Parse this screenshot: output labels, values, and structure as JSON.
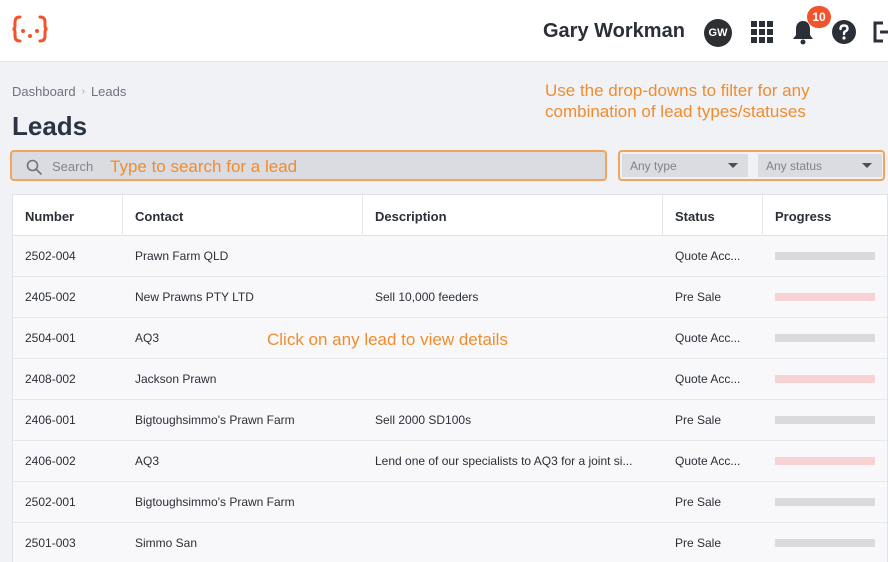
{
  "header": {
    "user_name": "Gary Workman",
    "avatar_initials": "GW",
    "notifications_count": "10",
    "icons": [
      "logo-icon",
      "apps-grid-icon",
      "bell-icon",
      "help-icon",
      "logout-icon"
    ],
    "accent_color": "#f0542c"
  },
  "breadcrumb": {
    "items": [
      "Dashboard",
      "Leads"
    ]
  },
  "page": {
    "title": "Leads"
  },
  "search": {
    "placeholder": "Search"
  },
  "filters": {
    "type_label": "Any type",
    "status_label": "Any status"
  },
  "hints": {
    "filter": "Use the drop-downs to filter for any combination of lead types/statuses",
    "search": "Type to search for a lead",
    "click": "Click on any lead to view details"
  },
  "table": {
    "columns": [
      "Number",
      "Contact",
      "Description",
      "Status",
      "Progress"
    ],
    "rows": [
      {
        "number": "2502-004",
        "contact": "Prawn Farm QLD",
        "description": "",
        "status": "Quote Acc...",
        "progress_color": "#d9dadd"
      },
      {
        "number": "2405-002",
        "contact": "New Prawns PTY LTD",
        "description": "Sell 10,000 feeders",
        "status": "Pre Sale",
        "progress_color": "#f8d2d2"
      },
      {
        "number": "2504-001",
        "contact": "AQ3",
        "description": "",
        "status": "Quote Acc...",
        "progress_color": "#d9dadd"
      },
      {
        "number": "2408-002",
        "contact": "Jackson Prawn",
        "description": "",
        "status": "Quote Acc...",
        "progress_color": "#f8d2d2"
      },
      {
        "number": "2406-001",
        "contact": "Bigtoughsimmo's Prawn Farm",
        "description": "Sell 2000 SD100s",
        "status": "Pre Sale",
        "progress_color": "#d9dadd"
      },
      {
        "number": "2406-002",
        "contact": "AQ3",
        "description": "Lend one of our specialists to AQ3 for a joint si...",
        "status": "Quote Acc...",
        "progress_color": "#f8d2d2"
      },
      {
        "number": "2502-001",
        "contact": "Bigtoughsimmo's Prawn Farm",
        "description": "",
        "status": "Pre Sale",
        "progress_color": "#d9dadd"
      },
      {
        "number": "2501-003",
        "contact": "Simmo San",
        "description": "",
        "status": "Pre Sale",
        "progress_color": "#d9dadd"
      }
    ]
  }
}
